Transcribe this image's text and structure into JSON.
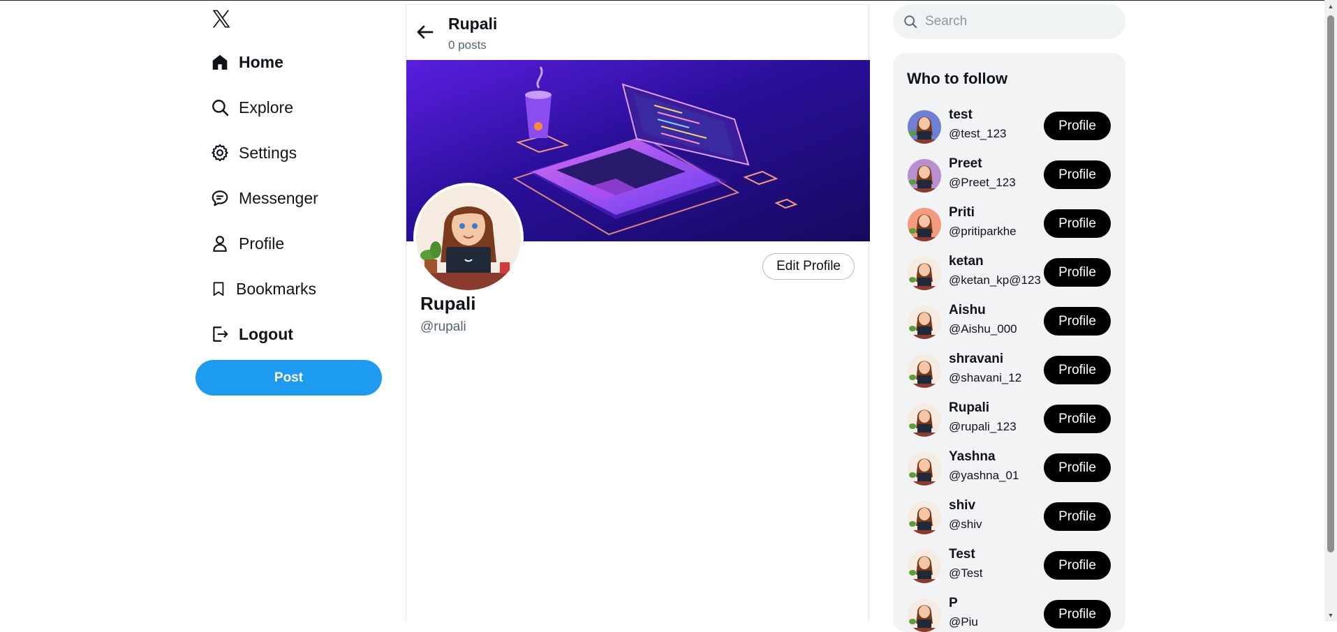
{
  "nav": {
    "logo": "x-logo-icon",
    "items": [
      {
        "label": "Home",
        "icon": "home-icon"
      },
      {
        "label": "Explore",
        "icon": "search-icon"
      },
      {
        "label": "Settings",
        "icon": "gear-icon"
      },
      {
        "label": "Messenger",
        "icon": "chat-icon"
      },
      {
        "label": "Profile",
        "icon": "user-icon"
      },
      {
        "label": "Bookmarks",
        "icon": "bookmark-icon"
      },
      {
        "label": "Logout",
        "icon": "logout-icon"
      }
    ],
    "post_label": "Post"
  },
  "header": {
    "name": "Rupali",
    "posts": "0 posts"
  },
  "profile": {
    "name": "Rupali",
    "handle": "@rupali",
    "edit_label": "Edit Profile"
  },
  "search": {
    "placeholder": "Search"
  },
  "who_to_follow": {
    "title": "Who to follow",
    "button_label": "Profile",
    "users": [
      {
        "name": "test",
        "handle": "@test_123"
      },
      {
        "name": "Preet",
        "handle": "@Preet_123"
      },
      {
        "name": "Priti",
        "handle": "@pritiparkhe"
      },
      {
        "name": "ketan",
        "handle": "@ketan_kp@123"
      },
      {
        "name": "Aishu",
        "handle": "@Aishu_000"
      },
      {
        "name": "shravani",
        "handle": "@shavani_12"
      },
      {
        "name": "Rupali",
        "handle": "@rupali_123"
      },
      {
        "name": "Yashna",
        "handle": "@yashna_01"
      },
      {
        "name": "shiv",
        "handle": "@shiv"
      },
      {
        "name": "Test",
        "handle": "@Test"
      },
      {
        "name": "P",
        "handle": "@Piu"
      }
    ]
  },
  "colors": {
    "accent": "#1d9bf0",
    "banner_dark": "#1c0b6e",
    "banner_light": "#5a1ee0"
  }
}
